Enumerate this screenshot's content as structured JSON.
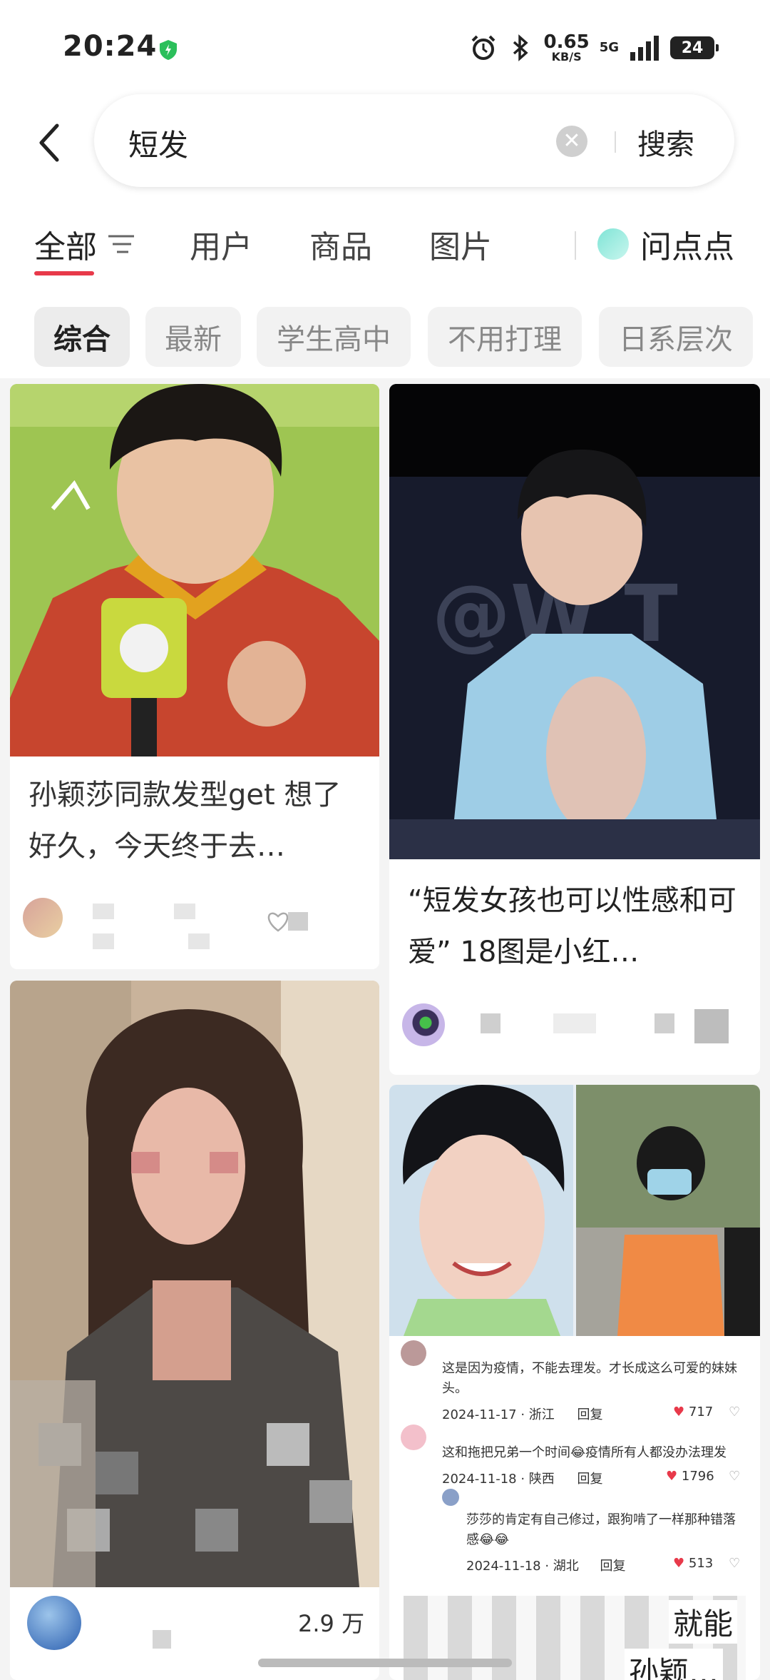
{
  "status_bar": {
    "time": "20:24",
    "net_speed_value": "0.65",
    "net_speed_unit": "KB/S",
    "network": "5G",
    "battery": "24"
  },
  "search": {
    "query": "短发",
    "clear_icon": "close-icon",
    "button_label": "搜索"
  },
  "tabs": [
    {
      "label": "全部"
    },
    {
      "label": "用户"
    },
    {
      "label": "商品"
    },
    {
      "label": "图片"
    }
  ],
  "wendiandian_label": "问点点",
  "chips": [
    {
      "label": "综合"
    },
    {
      "label": "最新"
    },
    {
      "label": "学生高中"
    },
    {
      "label": "不用打理"
    },
    {
      "label": "日系层次"
    }
  ],
  "feed": {
    "card1": {
      "title": "孙颖莎同款发型get 想了好久，今天终于去…"
    },
    "card2": {
      "title": "“短发女孩也可以性感和可爱” 18图是小红…"
    },
    "card3": {
      "likes": "2.9 万"
    },
    "card4": {
      "comments": [
        {
          "text": "这是因为疫情，不能去理发。才长成这么可爱的妹妹头。",
          "date": "2024-11-17 · 浙江",
          "reply": "回复",
          "likes": "717"
        },
        {
          "text": "这和拖把兄弟一个时间😂疫情所有人都没办法理发",
          "date": "2024-11-18 · 陕西",
          "reply": "回复",
          "likes": "1796"
        },
        {
          "text": "莎莎的肯定有自己修过，跟狗啃了一样那种错落感😂😂",
          "date": "2024-11-18 · 湖北",
          "reply": "回复",
          "likes": "513"
        }
      ],
      "title_fragments": [
        "就能",
        "孙颖…"
      ]
    }
  },
  "colors": {
    "accent": "#e8394a",
    "chip_bg": "#f2f2f2",
    "page_bg": "#f4f4f4"
  }
}
